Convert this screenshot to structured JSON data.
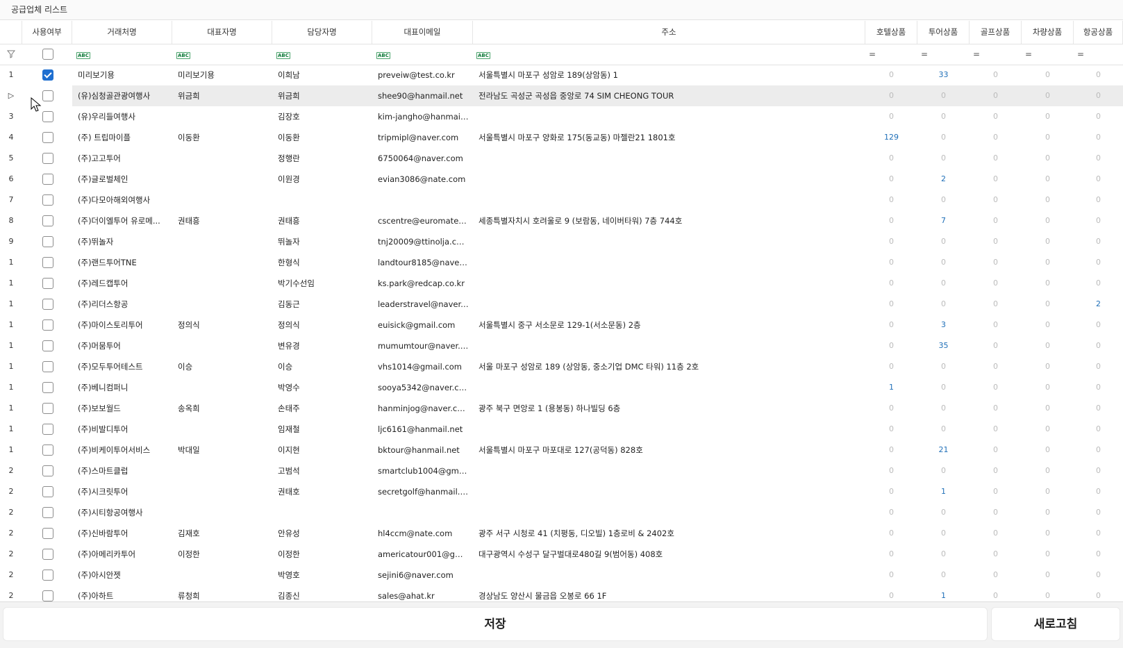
{
  "panel": {
    "title": "공급업체 리스트"
  },
  "columns": {
    "use": "사용여부",
    "vendor": "거래처명",
    "ceo": "대표자명",
    "manager": "담당자명",
    "email": "대표이메일",
    "address": "주소",
    "hotel": "호텔상품",
    "tour": "투어상품",
    "golf": "골프상품",
    "car": "차량상품",
    "air": "항공상품"
  },
  "filter": {
    "text_icon": "ABC",
    "num_icon": "="
  },
  "rows": [
    {
      "n": "1",
      "checked": true,
      "vendor": "미리보기용",
      "ceo": "미리보기용",
      "manager": "이희남",
      "email": "preveiw@test.co.kr",
      "address": "서울특별시 마포구 성암로 189(상암동) 1",
      "hotel": "0",
      "tour": "33",
      "golf": "0",
      "car": "0",
      "air": "0"
    },
    {
      "n": "▷",
      "checked": false,
      "vendor": "(유)심청골관광여행사",
      "ceo": "위금희",
      "manager": "위금희",
      "email": "shee90@hanmail.net",
      "address": "전라남도 곡성군 곡성읍 중앙로 74 SIM CHEONG TOUR",
      "hotel": "0",
      "tour": "0",
      "golf": "0",
      "car": "0",
      "air": "0",
      "selected": true
    },
    {
      "n": "3",
      "checked": false,
      "vendor": "(유)우리들여행사",
      "ceo": "",
      "manager": "김장호",
      "email": "kim-jangho@hanmail....",
      "address": "",
      "hotel": "0",
      "tour": "0",
      "golf": "0",
      "car": "0",
      "air": "0"
    },
    {
      "n": "4",
      "checked": false,
      "vendor": "(주) 트립마이플",
      "ceo": "이동환",
      "manager": "이동환",
      "email": "tripmipl@naver.com",
      "address": "서울특별시 마포구 양화로 175(동교동) 마젤란21 1801호",
      "hotel": "129",
      "tour": "0",
      "golf": "0",
      "car": "0",
      "air": "0"
    },
    {
      "n": "5",
      "checked": false,
      "vendor": "(주)고고투어",
      "ceo": "",
      "manager": "정행란",
      "email": "6750064@naver.com",
      "address": "",
      "hotel": "0",
      "tour": "0",
      "golf": "0",
      "car": "0",
      "air": "0"
    },
    {
      "n": "6",
      "checked": false,
      "vendor": "(주)글로벌체인",
      "ceo": "",
      "manager": "이원경",
      "email": "evian3086@nate.com",
      "address": "",
      "hotel": "0",
      "tour": "2",
      "golf": "0",
      "car": "0",
      "air": "0"
    },
    {
      "n": "7",
      "checked": false,
      "vendor": "(주)다모아해외여행사",
      "ceo": "",
      "manager": "",
      "email": "",
      "address": "",
      "hotel": "0",
      "tour": "0",
      "golf": "0",
      "car": "0",
      "air": "0"
    },
    {
      "n": "8",
      "checked": false,
      "vendor": "(주)더이엘투어 유로메...",
      "ceo": "권태흥",
      "manager": "권태흥",
      "email": "cscentre@euromate.c...",
      "address": "세종특별자치시 호려울로 9 (보람동, 네이버타워) 7층 744호",
      "hotel": "0",
      "tour": "7",
      "golf": "0",
      "car": "0",
      "air": "0"
    },
    {
      "n": "9",
      "checked": false,
      "vendor": "(주)뛰놀자",
      "ceo": "",
      "manager": "뛰놀자",
      "email": "tnj20009@ttinolja.com",
      "address": "",
      "hotel": "0",
      "tour": "0",
      "golf": "0",
      "car": "0",
      "air": "0"
    },
    {
      "n": "1",
      "checked": false,
      "vendor": "(주)랜드투어TNE",
      "ceo": "",
      "manager": "한형식",
      "email": "landtour8185@naver.c...",
      "address": "",
      "hotel": "0",
      "tour": "0",
      "golf": "0",
      "car": "0",
      "air": "0"
    },
    {
      "n": "1",
      "checked": false,
      "vendor": "(주)레드캡투어",
      "ceo": "",
      "manager": "박기수선임",
      "email": "ks.park@redcap.co.kr",
      "address": "",
      "hotel": "0",
      "tour": "0",
      "golf": "0",
      "car": "0",
      "air": "0"
    },
    {
      "n": "1",
      "checked": false,
      "vendor": "(주)리더스항공",
      "ceo": "",
      "manager": "김동근",
      "email": "leaderstravel@naver.c...",
      "address": "",
      "hotel": "0",
      "tour": "0",
      "golf": "0",
      "car": "0",
      "air": "2"
    },
    {
      "n": "1",
      "checked": false,
      "vendor": "(주)마이스토리투어",
      "ceo": "정의식",
      "manager": "정의식",
      "email": "euisick@gmail.com",
      "address": "서울특별시 중구 서소문로 129-1(서소문동) 2층",
      "hotel": "0",
      "tour": "3",
      "golf": "0",
      "car": "0",
      "air": "0"
    },
    {
      "n": "1",
      "checked": false,
      "vendor": "(주)머뭄투어",
      "ceo": "",
      "manager": "변유경",
      "email": "mumumtour@naver.c...",
      "address": "",
      "hotel": "0",
      "tour": "35",
      "golf": "0",
      "car": "0",
      "air": "0"
    },
    {
      "n": "1",
      "checked": false,
      "vendor": "(주)모두투어테스트",
      "ceo": "이승",
      "manager": "이승",
      "email": "vhs1014@gmail.com",
      "address": "서울 마포구 성암로 189 (상암동, 중소기업 DMC 타워) 11층 2호",
      "hotel": "0",
      "tour": "0",
      "golf": "0",
      "car": "0",
      "air": "0"
    },
    {
      "n": "1",
      "checked": false,
      "vendor": "(주)베니컴퍼니",
      "ceo": "",
      "manager": "박영수",
      "email": "sooya5342@naver.com",
      "address": "",
      "hotel": "1",
      "tour": "0",
      "golf": "0",
      "car": "0",
      "air": "0"
    },
    {
      "n": "1",
      "checked": false,
      "vendor": "(주)보보월드",
      "ceo": "송옥희",
      "manager": "손태주",
      "email": "hanminjog@naver.com",
      "address": "광주 북구 면앙로 1 (용봉동) 하나빌딩 6층",
      "hotel": "0",
      "tour": "0",
      "golf": "0",
      "car": "0",
      "air": "0"
    },
    {
      "n": "1",
      "checked": false,
      "vendor": "(주)비발디투어",
      "ceo": "",
      "manager": "임재철",
      "email": "ljc6161@hanmail.net",
      "address": "",
      "hotel": "0",
      "tour": "0",
      "golf": "0",
      "car": "0",
      "air": "0"
    },
    {
      "n": "1",
      "checked": false,
      "vendor": "(주)비케이투어서비스",
      "ceo": "박대일",
      "manager": "이지현",
      "email": "bktour@hanmail.net",
      "address": "서울특별시 마포구 마포대로 127(공덕동) 828호",
      "hotel": "0",
      "tour": "21",
      "golf": "0",
      "car": "0",
      "air": "0"
    },
    {
      "n": "2",
      "checked": false,
      "vendor": "(주)스마트클럽",
      "ceo": "",
      "manager": "고범석",
      "email": "smartclub1004@gmail....",
      "address": "",
      "hotel": "0",
      "tour": "0",
      "golf": "0",
      "car": "0",
      "air": "0"
    },
    {
      "n": "2",
      "checked": false,
      "vendor": "(주)시크릿투어",
      "ceo": "",
      "manager": "권태호",
      "email": "secretgolf@hanmail.net",
      "address": "",
      "hotel": "0",
      "tour": "1",
      "golf": "0",
      "car": "0",
      "air": "0"
    },
    {
      "n": "2",
      "checked": false,
      "vendor": "(주)시티항공여행사",
      "ceo": "",
      "manager": "",
      "email": "",
      "address": "",
      "hotel": "0",
      "tour": "0",
      "golf": "0",
      "car": "0",
      "air": "0"
    },
    {
      "n": "2",
      "checked": false,
      "vendor": "(주)신바람투어",
      "ceo": "김재호",
      "manager": "안유성",
      "email": "hl4ccm@nate.com",
      "address": "광주 서구 시청로 41 (치평동, 디오빌) 1층로비 & 2402호",
      "hotel": "0",
      "tour": "0",
      "golf": "0",
      "car": "0",
      "air": "0"
    },
    {
      "n": "2",
      "checked": false,
      "vendor": "(주)아메리카투어",
      "ceo": "이정한",
      "manager": "이정한",
      "email": "americatour001@gmai...",
      "address": "대구광역시 수성구 달구벌대로480길 9(범어동) 408호",
      "hotel": "0",
      "tour": "0",
      "golf": "0",
      "car": "0",
      "air": "0"
    },
    {
      "n": "2",
      "checked": false,
      "vendor": "(주)아시안젯",
      "ceo": "",
      "manager": "박영호",
      "email": "sejini6@naver.com",
      "address": "",
      "hotel": "0",
      "tour": "0",
      "golf": "0",
      "car": "0",
      "air": "0"
    },
    {
      "n": "2",
      "checked": false,
      "vendor": "(주)아하트",
      "ceo": "류청희",
      "manager": "김종신",
      "email": "sales@ahat.kr",
      "address": "경상남도 양산시 물금읍 오봉로 66 1F",
      "hotel": "0",
      "tour": "1",
      "golf": "0",
      "car": "0",
      "air": "0"
    }
  ],
  "buttons": {
    "save": "저장",
    "refresh": "새로고침"
  }
}
